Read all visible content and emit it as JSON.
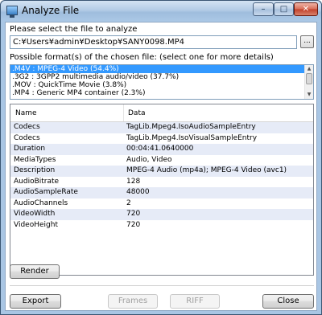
{
  "window": {
    "title": "Analyze File",
    "min": "–",
    "max": "□",
    "close": "✕"
  },
  "file_section": {
    "prompt": "Please select the file to analyze",
    "path": "C:¥Users¥admin¥Desktop¥SANY0098.MP4",
    "browse_label": "..."
  },
  "formats_section": {
    "prompt": "Possible format(s) of the chosen file: (select one for more details)",
    "items": [
      ".M4V : MPEG-4 Video (54.4%)",
      ".3G2 : 3GPP2 multimedia audio/video (37.7%)",
      ".MOV : QuickTime Movie (3.8%)",
      ".MP4 : Generic MP4 container (2.3%)"
    ],
    "selected_index": 0
  },
  "details": {
    "columns": [
      "Name",
      "Data"
    ],
    "rows": [
      {
        "name": "Codecs",
        "data": "TagLib.Mpeg4.IsoAudioSampleEntry"
      },
      {
        "name": "Codecs",
        "data": "TagLib.Mpeg4.IsoVisualSampleEntry"
      },
      {
        "name": "Duration",
        "data": "00:04:41.0640000"
      },
      {
        "name": "MediaTypes",
        "data": "Audio, Video"
      },
      {
        "name": "Description",
        "data": "MPEG-4 Audio (mp4a); MPEG-4 Video (avc1)"
      },
      {
        "name": "AudioBitrate",
        "data": "128"
      },
      {
        "name": "AudioSampleRate",
        "data": "48000"
      },
      {
        "name": "AudioChannels",
        "data": "2"
      },
      {
        "name": "VideoWidth",
        "data": "720"
      },
      {
        "name": "VideoHeight",
        "data": "720"
      }
    ]
  },
  "buttons": {
    "render": "Render",
    "export": "Export",
    "frames": "Frames",
    "riff": "RIFF",
    "close": "Close"
  }
}
